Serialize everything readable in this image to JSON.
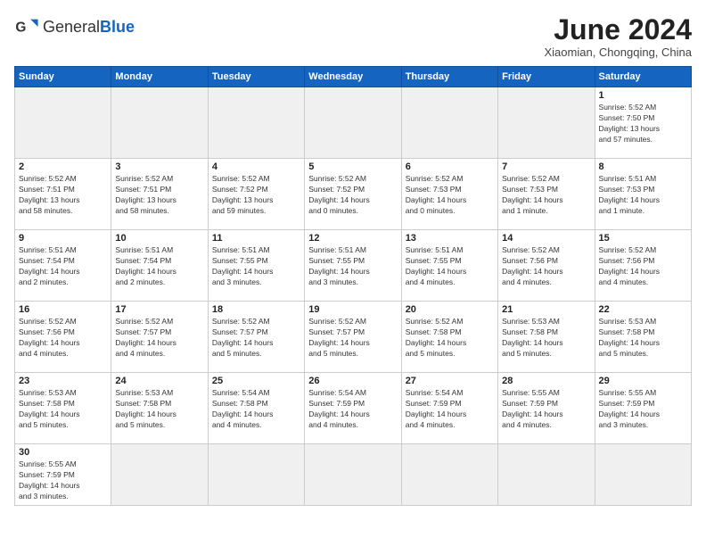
{
  "header": {
    "logo_general": "General",
    "logo_blue": "Blue",
    "month_title": "June 2024",
    "subtitle": "Xiaomian, Chongqing, China"
  },
  "weekdays": [
    "Sunday",
    "Monday",
    "Tuesday",
    "Wednesday",
    "Thursday",
    "Friday",
    "Saturday"
  ],
  "days": {
    "1": {
      "sunrise": "5:52 AM",
      "sunset": "7:50 PM",
      "daylight": "13 hours and 57 minutes."
    },
    "2": {
      "sunrise": "5:52 AM",
      "sunset": "7:51 PM",
      "daylight": "13 hours and 58 minutes."
    },
    "3": {
      "sunrise": "5:52 AM",
      "sunset": "7:51 PM",
      "daylight": "13 hours and 58 minutes."
    },
    "4": {
      "sunrise": "5:52 AM",
      "sunset": "7:52 PM",
      "daylight": "13 hours and 59 minutes."
    },
    "5": {
      "sunrise": "5:52 AM",
      "sunset": "7:52 PM",
      "daylight": "14 hours and 0 minutes."
    },
    "6": {
      "sunrise": "5:52 AM",
      "sunset": "7:53 PM",
      "daylight": "14 hours and 0 minutes."
    },
    "7": {
      "sunrise": "5:52 AM",
      "sunset": "7:53 PM",
      "daylight": "14 hours and 1 minute."
    },
    "8": {
      "sunrise": "5:51 AM",
      "sunset": "7:53 PM",
      "daylight": "14 hours and 1 minute."
    },
    "9": {
      "sunrise": "5:51 AM",
      "sunset": "7:54 PM",
      "daylight": "14 hours and 2 minutes."
    },
    "10": {
      "sunrise": "5:51 AM",
      "sunset": "7:54 PM",
      "daylight": "14 hours and 2 minutes."
    },
    "11": {
      "sunrise": "5:51 AM",
      "sunset": "7:55 PM",
      "daylight": "14 hours and 3 minutes."
    },
    "12": {
      "sunrise": "5:51 AM",
      "sunset": "7:55 PM",
      "daylight": "14 hours and 3 minutes."
    },
    "13": {
      "sunrise": "5:51 AM",
      "sunset": "7:55 PM",
      "daylight": "14 hours and 4 minutes."
    },
    "14": {
      "sunrise": "5:52 AM",
      "sunset": "7:56 PM",
      "daylight": "14 hours and 4 minutes."
    },
    "15": {
      "sunrise": "5:52 AM",
      "sunset": "7:56 PM",
      "daylight": "14 hours and 4 minutes."
    },
    "16": {
      "sunrise": "5:52 AM",
      "sunset": "7:56 PM",
      "daylight": "14 hours and 4 minutes."
    },
    "17": {
      "sunrise": "5:52 AM",
      "sunset": "7:57 PM",
      "daylight": "14 hours and 4 minutes."
    },
    "18": {
      "sunrise": "5:52 AM",
      "sunset": "7:57 PM",
      "daylight": "14 hours and 5 minutes."
    },
    "19": {
      "sunrise": "5:52 AM",
      "sunset": "7:57 PM",
      "daylight": "14 hours and 5 minutes."
    },
    "20": {
      "sunrise": "5:52 AM",
      "sunset": "7:58 PM",
      "daylight": "14 hours and 5 minutes."
    },
    "21": {
      "sunrise": "5:53 AM",
      "sunset": "7:58 PM",
      "daylight": "14 hours and 5 minutes."
    },
    "22": {
      "sunrise": "5:53 AM",
      "sunset": "7:58 PM",
      "daylight": "14 hours and 5 minutes."
    },
    "23": {
      "sunrise": "5:53 AM",
      "sunset": "7:58 PM",
      "daylight": "14 hours and 5 minutes."
    },
    "24": {
      "sunrise": "5:53 AM",
      "sunset": "7:58 PM",
      "daylight": "14 hours and 5 minutes."
    },
    "25": {
      "sunrise": "5:54 AM",
      "sunset": "7:58 PM",
      "daylight": "14 hours and 4 minutes."
    },
    "26": {
      "sunrise": "5:54 AM",
      "sunset": "7:59 PM",
      "daylight": "14 hours and 4 minutes."
    },
    "27": {
      "sunrise": "5:54 AM",
      "sunset": "7:59 PM",
      "daylight": "14 hours and 4 minutes."
    },
    "28": {
      "sunrise": "5:55 AM",
      "sunset": "7:59 PM",
      "daylight": "14 hours and 4 minutes."
    },
    "29": {
      "sunrise": "5:55 AM",
      "sunset": "7:59 PM",
      "daylight": "14 hours and 3 minutes."
    },
    "30": {
      "sunrise": "5:55 AM",
      "sunset": "7:59 PM",
      "daylight": "14 hours and 3 minutes."
    }
  }
}
